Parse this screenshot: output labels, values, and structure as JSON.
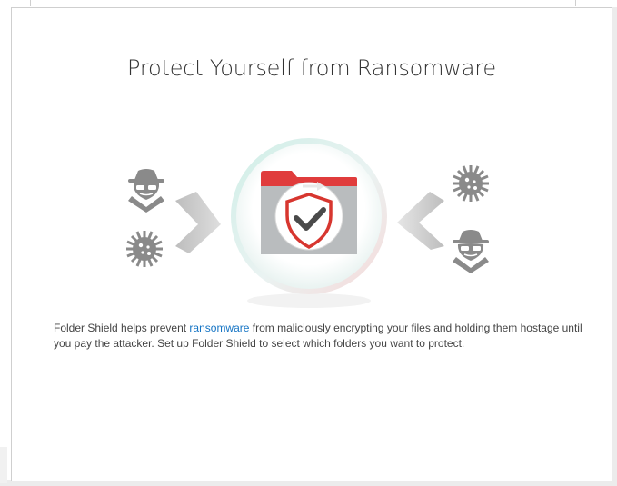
{
  "dialog": {
    "title": "Protect Yourself from Ransomware",
    "description": {
      "before_link": "Folder Shield helps prevent ",
      "link_text": "ransomware",
      "after_link": " from maliciously encrypting your files and holding them hostage until you pay the attacker. Set up Folder Shield to select which folders you want to protect."
    }
  },
  "illustration": {
    "left_icons": [
      "hacker-icon",
      "virus-icon"
    ],
    "center_icon": "shielded-folder-icon",
    "right_icons": [
      "virus-icon",
      "hacker-icon"
    ],
    "colors": {
      "icon_gray": "#8a8a8a",
      "folder_red": "#e03c3c",
      "folder_gray": "#b9bcbe",
      "check_dark": "#4a4a4a"
    }
  }
}
